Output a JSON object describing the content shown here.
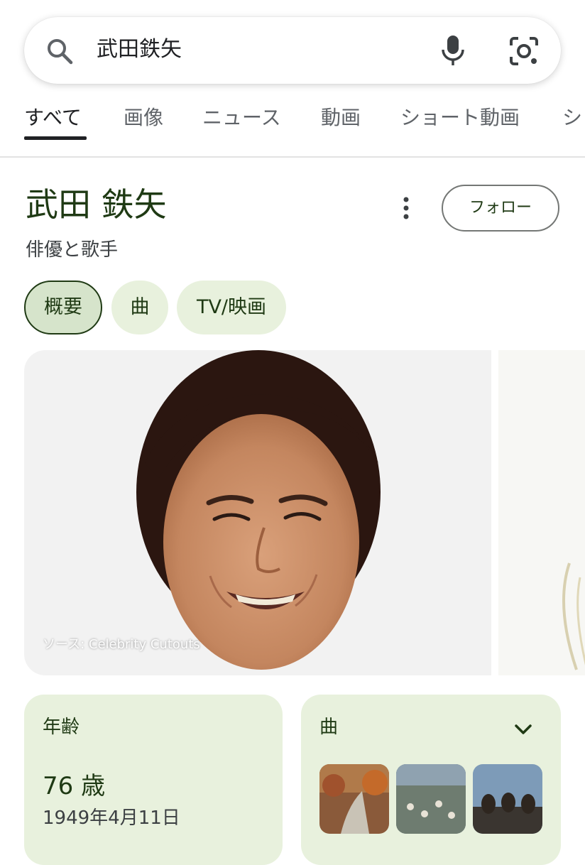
{
  "search": {
    "query": "武田鉄矢"
  },
  "tabs": [
    {
      "label": "すべて"
    },
    {
      "label": "画像"
    },
    {
      "label": "ニュース"
    },
    {
      "label": "動画"
    },
    {
      "label": "ショート動画"
    },
    {
      "label": "シ"
    }
  ],
  "entity": {
    "title": "武田 鉄矢",
    "subtitle": "俳優と歌手",
    "follow_label": "フォロー"
  },
  "chips": [
    {
      "label": "概要"
    },
    {
      "label": "曲"
    },
    {
      "label": "TV/映画"
    }
  ],
  "images": {
    "source": "ソース: Celebrity Cutouts"
  },
  "age_card": {
    "label": "年齢",
    "value": "76 歳",
    "birthdate": "1949年4月11日"
  },
  "songs_card": {
    "label": "曲"
  },
  "colors": {
    "accent_green": "#1f3a14",
    "chip_bg": "#e8f1dd",
    "card_bg": "#e8f1dd"
  }
}
